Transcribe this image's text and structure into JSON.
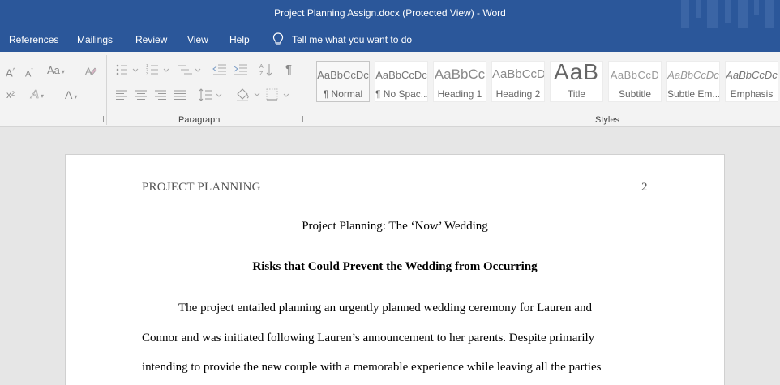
{
  "window": {
    "title": "Project Planning Assign.docx (Protected View)  -  Word"
  },
  "menu": {
    "items": [
      "References",
      "Mailings",
      "Review",
      "View",
      "Help"
    ],
    "tell_me": "Tell me what you want to do"
  },
  "ribbon": {
    "paragraph_label": "Paragraph",
    "styles_label": "Styles",
    "font_icons": {
      "grow": "A",
      "shrink": "A",
      "change_case": "Aa",
      "superscript": "x²",
      "text_effects": "A",
      "font_color": "A"
    },
    "styles": [
      {
        "preview": "AaBbCcDc",
        "name": "¶ Normal"
      },
      {
        "preview": "AaBbCcDc",
        "name": "¶ No Spac..."
      },
      {
        "preview": "AaBbCc",
        "name": "Heading 1"
      },
      {
        "preview": "AaBbCcD",
        "name": "Heading 2"
      },
      {
        "preview": "AaB",
        "name": "Title"
      },
      {
        "preview": "AaBbCcD",
        "name": "Subtitle"
      },
      {
        "preview": "AaBbCcDc",
        "name": "Subtle Em..."
      },
      {
        "preview": "AaBbCcDc",
        "name": "Emphasis"
      }
    ]
  },
  "document": {
    "running_head": "PROJECT PLANNING",
    "page_number": "2",
    "title": "Project Planning: The ‘Now’ Wedding",
    "heading": "Risks that Could Prevent the Wedding from Occurring",
    "lines": [
      "The project entailed planning an urgently planned wedding ceremony for Lauren and",
      "Connor and was initiated following Lauren’s announcement to her parents. Despite primarily",
      "intending to provide the new couple with a memorable experience while leaving all the parties"
    ]
  }
}
